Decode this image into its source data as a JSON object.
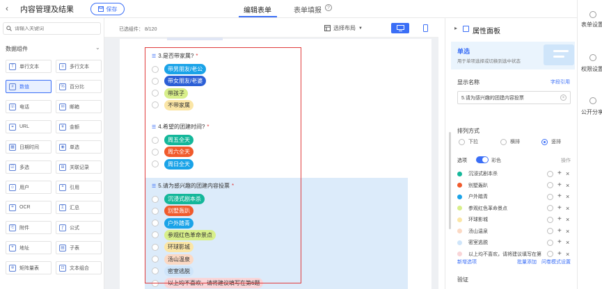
{
  "header": {
    "back_icon": "‹",
    "title": "内容管理及结果",
    "save_label": "保存",
    "tabs": [
      {
        "label": "编辑表单"
      },
      {
        "label": "表单填报"
      }
    ],
    "help_icon": "?"
  },
  "left_panel": {
    "search_placeholder": "请输入关键词",
    "group_title": "数据组件",
    "components": [
      {
        "label": "单行文本",
        "icon": "T"
      },
      {
        "label": "多行文本",
        "icon": "≡"
      },
      {
        "label": "数值",
        "icon": "#"
      },
      {
        "label": "百分比",
        "icon": "%"
      },
      {
        "label": "电话",
        "icon": "☏"
      },
      {
        "label": "邮箱",
        "icon": "✉"
      },
      {
        "label": "URL",
        "icon": "⚭"
      },
      {
        "label": "金额",
        "icon": "¥"
      },
      {
        "label": "日期时间",
        "icon": "▦"
      },
      {
        "label": "单选",
        "icon": "◉"
      },
      {
        "label": "多选",
        "icon": "☑"
      },
      {
        "label": "关联记录",
        "icon": "⊞"
      },
      {
        "label": "用户",
        "icon": "☺"
      },
      {
        "label": "引用",
        "icon": "❝"
      },
      {
        "label": "OCR",
        "icon": "⌗"
      },
      {
        "label": "汇总",
        "icon": "Σ"
      },
      {
        "label": "附件",
        "icon": "⎘"
      },
      {
        "label": "公式",
        "icon": "ƒ"
      },
      {
        "label": "地址",
        "icon": "⌖"
      },
      {
        "label": "子表",
        "icon": "▤"
      },
      {
        "label": "矩阵量表",
        "icon": "✲"
      },
      {
        "label": "文本组合",
        "icon": "⊡"
      }
    ]
  },
  "canvas": {
    "selected_count": "已选组件：  8/120",
    "layout_label": "选择布局",
    "questions": [
      {
        "title": "3.是否带家属?",
        "required": "*",
        "options": [
          {
            "label": "带男朋友/老公",
            "bg": "#1aa3e8",
            "fg": "#ffffff"
          },
          {
            "label": "带女朋友/老婆",
            "bg": "#2c5fd6",
            "fg": "#ffffff"
          },
          {
            "label": "带孩子",
            "bg": "#d8ef8a",
            "fg": "#333333"
          },
          {
            "label": "不带家属",
            "bg": "#fbe6a6",
            "fg": "#333333"
          }
        ]
      },
      {
        "title": "4.希望的团建时间?",
        "required": "*",
        "options": [
          {
            "label": "周五全天",
            "bg": "#14b79a",
            "fg": "#ffffff"
          },
          {
            "label": "周六全天",
            "bg": "#f05a2c",
            "fg": "#ffffff"
          },
          {
            "label": "周日全天",
            "bg": "#1aa3e8",
            "fg": "#ffffff"
          }
        ]
      },
      {
        "title": "5.请为感兴趣的团建内容投票",
        "required": "*",
        "options": [
          {
            "label": "沉浸式剧本杀",
            "bg": "#14b79a",
            "fg": "#ffffff"
          },
          {
            "label": "别墅轰趴",
            "bg": "#f05a2c",
            "fg": "#ffffff"
          },
          {
            "label": "户外踏青",
            "bg": "#1aa3e8",
            "fg": "#ffffff"
          },
          {
            "label": "参观红色革命景点",
            "bg": "#d8ef8a",
            "fg": "#333333"
          },
          {
            "label": "环球影城",
            "bg": "#fbe6a6",
            "fg": "#333333"
          },
          {
            "label": "汤山温泉",
            "bg": "#fbd9c4",
            "fg": "#333333"
          },
          {
            "label": "密室逃脱",
            "bg": "#cfe5fa",
            "fg": "#333333"
          },
          {
            "label": "以上均不喜欢，请将建议填写在第6题",
            "bg": "#f9d5d8",
            "fg": "#333333"
          }
        ]
      }
    ]
  },
  "right_panel": {
    "title": "属性面板",
    "banner_title": "单选",
    "banner_desc": "用于单项选择或切换到选中状态",
    "display_name_label": "显示名称",
    "field_ref_label": "字段引用",
    "display_name_value": "5.请为感兴趣的团建内容投票",
    "sort_label": "排列方式",
    "sort_options": [
      "下拉",
      "横排",
      "竖排"
    ],
    "sort_selected": "竖排",
    "options_label": "选项",
    "color_label": "彩色",
    "ops_label": "操作",
    "option_rows": [
      {
        "label": "沉浸式剧本杀",
        "color": "#14b79a"
      },
      {
        "label": "别墅轰趴",
        "color": "#f05a2c"
      },
      {
        "label": "户外踏青",
        "color": "#1aa3e8"
      },
      {
        "label": "参观红色革命景点",
        "color": "#d8ef8a"
      },
      {
        "label": "环球影城",
        "color": "#fbe6a6"
      },
      {
        "label": "汤山温泉",
        "color": "#fbd9c4"
      },
      {
        "label": "密室逃脱",
        "color": "#cfe5fa"
      },
      {
        "label": "以上均不喜欢，请将建议填写在第",
        "color": "#f9d5d8"
      }
    ],
    "add_option": "新增选项",
    "batch_add": "批量添加",
    "q_mode": "问卷模式设置",
    "verify_label": "验证"
  },
  "far_right": {
    "items": [
      {
        "label": "表单设置"
      },
      {
        "label": "权限设置"
      },
      {
        "label": "公开分享"
      }
    ]
  },
  "colors": {
    "accent": "#3a6ef6",
    "highlight": "#dcebfa",
    "annotation": "#e03a3a"
  }
}
